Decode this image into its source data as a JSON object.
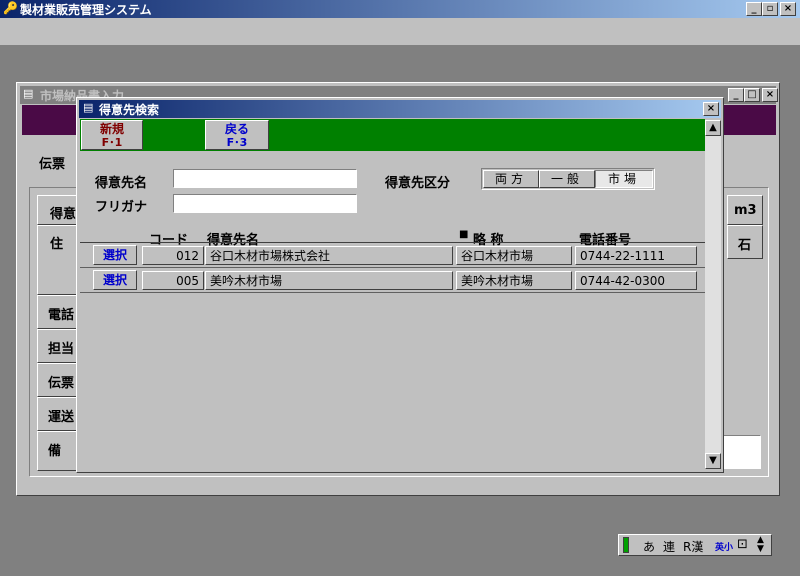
{
  "app": {
    "title": "製材業販売管理システム",
    "controls": [
      "_",
      "▫",
      "×"
    ]
  },
  "bg_form": {
    "title": "市場納品書入力",
    "left_labels": [
      "伝票",
      "得意",
      "住",
      "電話",
      "担当",
      "伝票",
      "運送",
      "備"
    ],
    "right_labels": [
      "m3",
      "石"
    ]
  },
  "dialog": {
    "title": "得意先検索",
    "close": "×",
    "toolbar": {
      "new_label": "新規",
      "new_key": "F･1",
      "back_label": "戻る",
      "back_key": "F･3"
    },
    "search": {
      "name_label": "得意先名",
      "name_value": "",
      "kana_label": "フリガナ",
      "kana_value": "",
      "category_label": "得意先区分",
      "categories": [
        "両方",
        "一般",
        "市場"
      ],
      "selected_category": "市場"
    },
    "table": {
      "headers": {
        "code": "コード",
        "name": "得意先名",
        "short": "略 称",
        "phone": "電話番号"
      },
      "select_label": "選択",
      "rows": [
        {
          "code": "012",
          "name": "谷口木材市場株式会社",
          "short": "谷口木材市場",
          "phone": "0744-22-1111"
        },
        {
          "code": "005",
          "name": "美吟木材市場",
          "short": "美吟木材市場",
          "phone": "0744-42-0300"
        }
      ]
    }
  },
  "ime": {
    "items": [
      "あ",
      "連",
      "R漢",
      "英小"
    ]
  }
}
